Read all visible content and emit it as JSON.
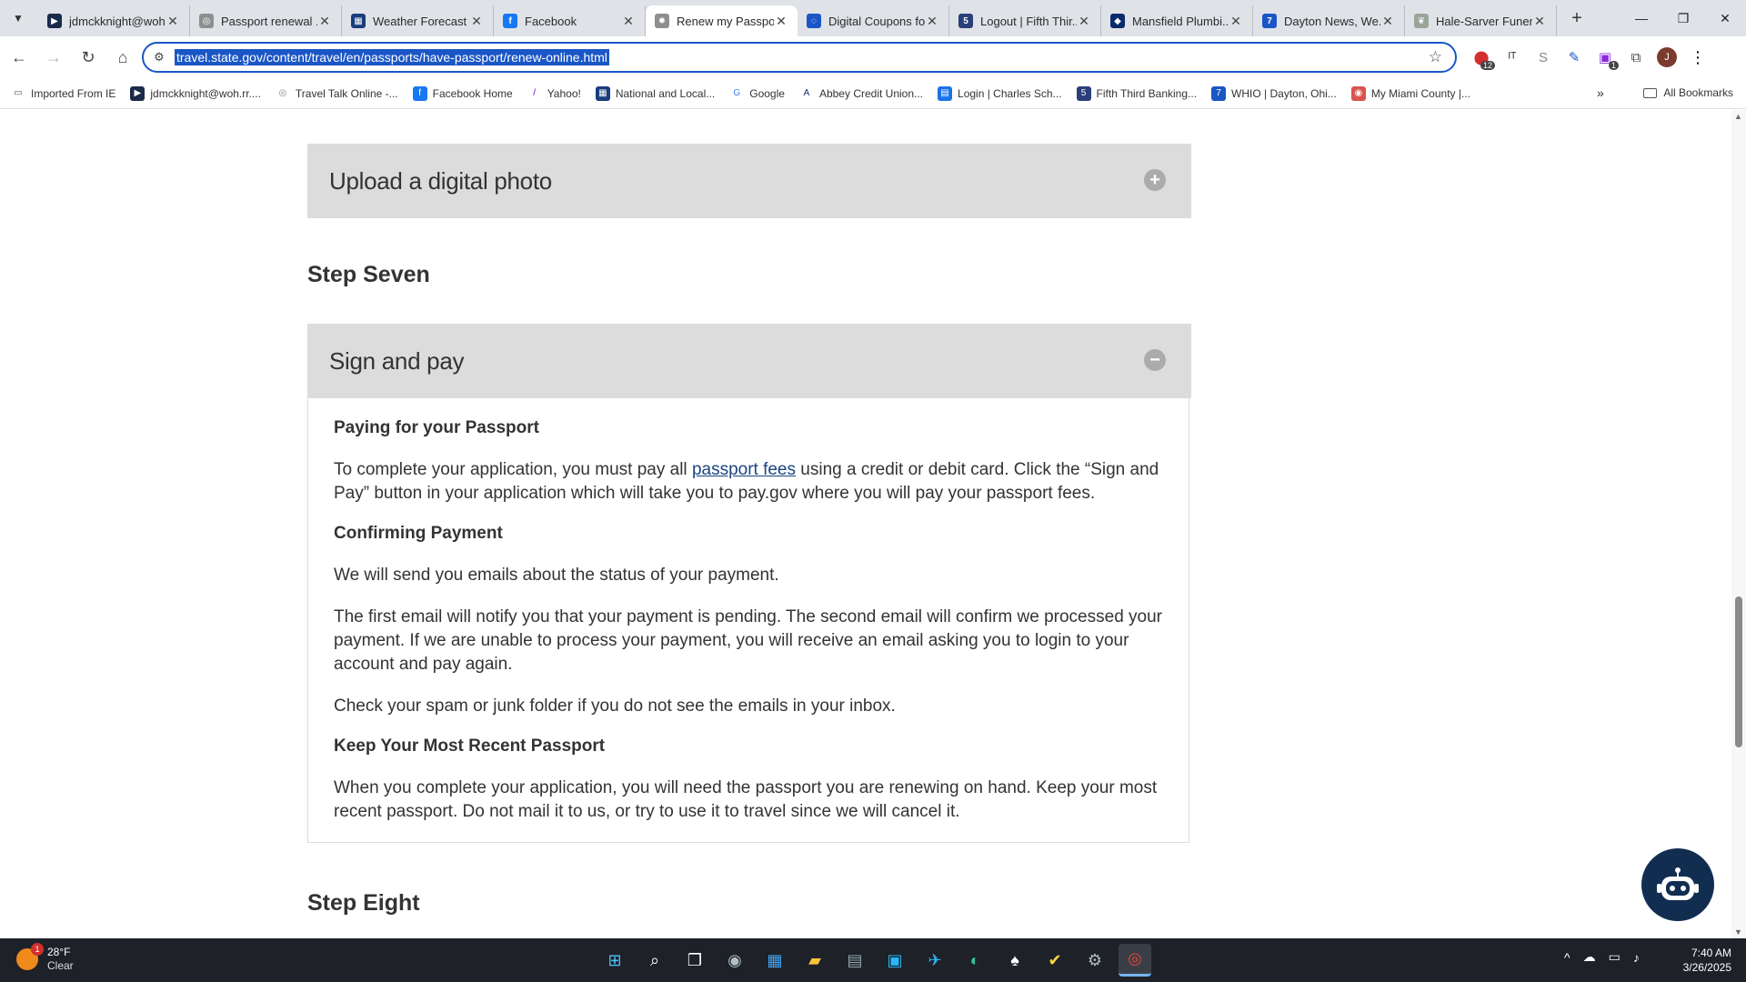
{
  "browser": {
    "tabs": [
      {
        "title": "jdmckknight@woh...",
        "color": "#1a2b4a",
        "glyph": "▶"
      },
      {
        "title": "Passport renewal ...",
        "color": "#8e8e8e",
        "glyph": "◎"
      },
      {
        "title": "Weather Forecast ...",
        "color": "#1a3d7c",
        "glyph": "▦"
      },
      {
        "title": "Facebook",
        "color": "#1877f2",
        "glyph": "f"
      },
      {
        "title": "Renew my Passpo...",
        "color": "#8e8e8e",
        "glyph": "✹",
        "active": true
      },
      {
        "title": "Digital Coupons fo...",
        "color": "#1a56c6",
        "glyph": "◌"
      },
      {
        "title": "Logout | Fifth Thir...",
        "color": "#2a3f7a",
        "glyph": "5"
      },
      {
        "title": "Mansfield Plumbi...",
        "color": "#0b2a6b",
        "glyph": "◆"
      },
      {
        "title": "Dayton News, We...",
        "color": "#1a56c6",
        "glyph": "7"
      },
      {
        "title": "Hale-Sarver Funer...",
        "color": "#9aa59a",
        "glyph": "❦"
      }
    ],
    "new_tab": "+",
    "window": {
      "minimize": "—",
      "restore": "❐",
      "close": "✕"
    },
    "nav": {
      "back": "←",
      "forward": "→",
      "reload": "↻",
      "home": "⌂"
    },
    "url": "travel.state.gov/content/travel/en/passports/have-passport/renew-online.html",
    "star": "☆",
    "extensions": [
      {
        "name": "adblock-extension-icon",
        "glyph": "⬤",
        "color": "#d32f2f",
        "badge": "12"
      },
      {
        "name": "translate-extension-icon",
        "glyph": "ᴵᵀ",
        "color": "#333"
      },
      {
        "name": "s-extension-icon",
        "glyph": "S",
        "color": "#888"
      },
      {
        "name": "pen-extension-icon",
        "glyph": "✎",
        "color": "#1a56c6"
      },
      {
        "name": "purple-extension-icon",
        "glyph": "▣",
        "color": "#8a2be2",
        "badge": "1"
      },
      {
        "name": "puzzle-extension-icon",
        "glyph": "⧉",
        "color": "#444"
      }
    ],
    "avatar_initial": "J",
    "menu": "⋮",
    "bookmarks": [
      {
        "label": "Imported From IE",
        "color": "#ffffff",
        "glyph": "▭",
        "fg": "#555"
      },
      {
        "label": "jdmckknight@woh.rr....",
        "color": "#1a2b4a",
        "glyph": "▶",
        "fg": "#fff"
      },
      {
        "label": "Travel Talk Online -...",
        "color": "#ffffff",
        "glyph": "◎",
        "fg": "#888"
      },
      {
        "label": "Facebook  Home",
        "color": "#1877f2",
        "glyph": "f",
        "fg": "#fff"
      },
      {
        "label": "Yahoo!",
        "color": "#ffffff",
        "glyph": "/",
        "fg": "#6001d2"
      },
      {
        "label": "National and Local...",
        "color": "#1a3d7c",
        "glyph": "▦",
        "fg": "#fff"
      },
      {
        "label": "Google",
        "color": "#ffffff",
        "glyph": "G",
        "fg": "#4285f4"
      },
      {
        "label": "Abbey Credit Union...",
        "color": "#ffffff",
        "glyph": "A",
        "fg": "#0b2a6b"
      },
      {
        "label": "Login | Charles Sch...",
        "color": "#1a73e8",
        "glyph": "▤",
        "fg": "#fff"
      },
      {
        "label": "Fifth Third Banking...",
        "color": "#2a3f7a",
        "glyph": "5",
        "fg": "#fff"
      },
      {
        "label": "WHIO | Dayton, Ohi...",
        "color": "#1a56c6",
        "glyph": "7",
        "fg": "#fff"
      },
      {
        "label": "My Miami County |...",
        "color": "#d9534f",
        "glyph": "◉",
        "fg": "#fff"
      }
    ],
    "bookmarks_more": "»",
    "all_bookmarks": "All Bookmarks"
  },
  "page": {
    "upload_header": "Upload a digital photo",
    "step_seven": "Step Seven",
    "sign_header": "Sign and pay",
    "paying_heading": "Paying for your Passport",
    "paying_before": "To complete your application, you must pay all ",
    "paying_link": "passport fees",
    "paying_after": " using a credit or debit card. Click the “Sign and Pay” button in your application which will take you to pay.gov where you will pay your passport fees.",
    "confirm_heading": "Confirming Payment",
    "confirm_p1": "We will send you emails about the status of your payment.",
    "confirm_p2": "The first email will notify you that your payment is pending. The second email will confirm we processed your payment. If we are unable to process your payment, you will receive an email asking you to login to your account and pay again.",
    "confirm_p3": "Check your spam or junk folder if you do not see the emails in your inbox.",
    "keep_heading": "Keep Your Most Recent Passport",
    "keep_p1": "When you complete your application, you will need the passport you are renewing on hand. Keep your most recent passport. Do not mail it to us, or try to use it to travel since we will cancel it.",
    "step_eight": "Step Eight",
    "expand_glyph": "+",
    "collapse_glyph": "−"
  },
  "taskbar": {
    "weather_badge": "1",
    "temperature": "28°F",
    "condition": "Clear",
    "apps": [
      {
        "name": "start-icon",
        "glyph": "⊞",
        "color": "#4cc2ff"
      },
      {
        "name": "search-icon",
        "glyph": "⌕",
        "color": "#ffffff"
      },
      {
        "name": "task-view-icon",
        "glyph": "❐",
        "color": "#ffffff"
      },
      {
        "name": "camera-app-icon",
        "glyph": "◉",
        "color": "#b0bec5"
      },
      {
        "name": "calendar-app-icon",
        "glyph": "▦",
        "color": "#42a5f5"
      },
      {
        "name": "file-explorer-icon",
        "glyph": "▰",
        "color": "#f9c33c"
      },
      {
        "name": "calculator-app-icon",
        "glyph": "▤",
        "color": "#90a4ae"
      },
      {
        "name": "store-app-icon",
        "glyph": "▣",
        "color": "#29b6f6"
      },
      {
        "name": "maps-app-icon",
        "glyph": "✈",
        "color": "#29b6f6"
      },
      {
        "name": "edge-browser-icon",
        "glyph": "◐",
        "color": "#35c1a1"
      },
      {
        "name": "solitaire-app-icon",
        "glyph": "♠",
        "color": "#ffffff"
      },
      {
        "name": "norton-app-icon",
        "glyph": "✔",
        "color": "#fdd835"
      },
      {
        "name": "settings-app-icon",
        "glyph": "⚙",
        "color": "#b0bec5"
      },
      {
        "name": "chrome-browser-icon",
        "glyph": "◎",
        "color": "#ea4335",
        "running": true
      }
    ],
    "tray": {
      "chevron": "^",
      "cloud": "☁",
      "network": "▭",
      "volume": "♪"
    },
    "time": "7:40 AM",
    "date": "3/26/2025"
  }
}
